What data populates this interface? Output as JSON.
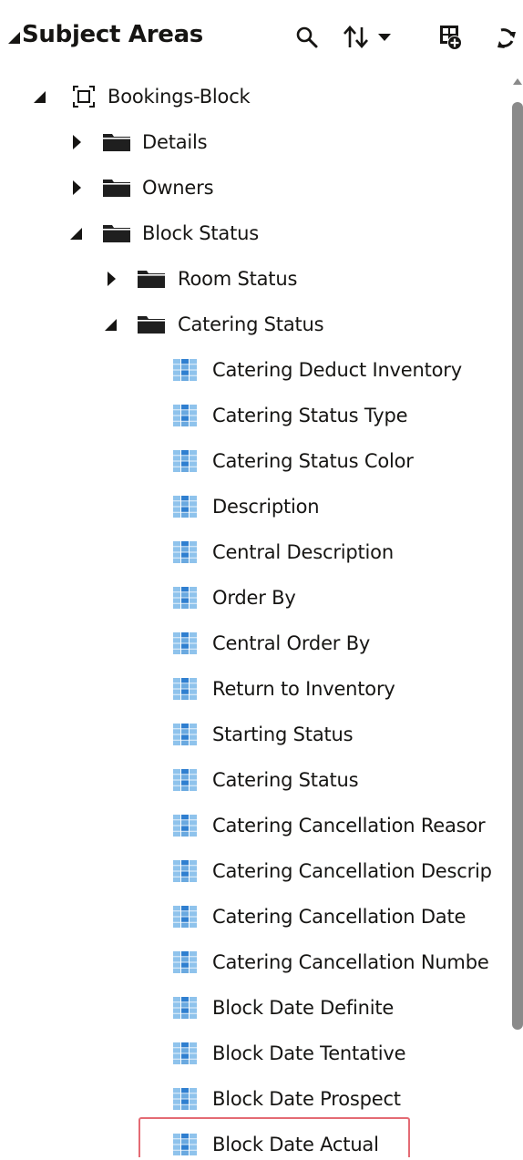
{
  "header": {
    "title": "Subject Areas",
    "icons": [
      "search-icon",
      "sort-icon",
      "chevron-down-icon",
      "add-to-canvas-icon",
      "refresh-icon"
    ]
  },
  "tree": {
    "nodes": [
      {
        "label": "Bookings-Block",
        "level": 0,
        "state": "expanded",
        "icon": "subject-area-icon"
      },
      {
        "label": "Details",
        "level": 1,
        "state": "collapsed",
        "icon": "folder-icon"
      },
      {
        "label": "Owners",
        "level": 1,
        "state": "collapsed",
        "icon": "folder-icon"
      },
      {
        "label": "Block Status",
        "level": 1,
        "state": "expanded",
        "icon": "folder-icon"
      },
      {
        "label": "Room Status",
        "level": 2,
        "state": "collapsed",
        "icon": "folder-icon"
      },
      {
        "label": "Catering Status",
        "level": 2,
        "state": "expanded",
        "icon": "folder-icon"
      },
      {
        "label": "Catering Deduct Inventory",
        "level": 3,
        "state": "leaf",
        "icon": "column-icon"
      },
      {
        "label": "Catering Status Type",
        "level": 3,
        "state": "leaf",
        "icon": "column-icon"
      },
      {
        "label": "Catering Status Color",
        "level": 3,
        "state": "leaf",
        "icon": "column-icon"
      },
      {
        "label": "Description",
        "level": 3,
        "state": "leaf",
        "icon": "column-icon"
      },
      {
        "label": "Central Description",
        "level": 3,
        "state": "leaf",
        "icon": "column-icon"
      },
      {
        "label": "Order By",
        "level": 3,
        "state": "leaf",
        "icon": "column-icon"
      },
      {
        "label": "Central Order By",
        "level": 3,
        "state": "leaf",
        "icon": "column-icon"
      },
      {
        "label": "Return to Inventory",
        "level": 3,
        "state": "leaf",
        "icon": "column-icon"
      },
      {
        "label": "Starting Status",
        "level": 3,
        "state": "leaf",
        "icon": "column-icon"
      },
      {
        "label": "Catering Status",
        "level": 3,
        "state": "leaf",
        "icon": "column-icon"
      },
      {
        "label": "Catering Cancellation Reasor",
        "level": 3,
        "state": "leaf",
        "icon": "column-icon"
      },
      {
        "label": "Catering Cancellation Descrip",
        "level": 3,
        "state": "leaf",
        "icon": "column-icon"
      },
      {
        "label": "Catering Cancellation Date",
        "level": 3,
        "state": "leaf",
        "icon": "column-icon"
      },
      {
        "label": "Catering Cancellation Numbe",
        "level": 3,
        "state": "leaf",
        "icon": "column-icon"
      },
      {
        "label": "Block Date Definite",
        "level": 3,
        "state": "leaf",
        "icon": "column-icon"
      },
      {
        "label": "Block Date Tentative",
        "level": 3,
        "state": "leaf",
        "icon": "column-icon"
      },
      {
        "label": "Block Date Prospect",
        "level": 3,
        "state": "leaf",
        "icon": "column-icon"
      },
      {
        "label": "Block Date Actual",
        "level": 3,
        "state": "leaf",
        "icon": "column-icon",
        "highlighted": true
      }
    ]
  },
  "colors": {
    "text": "#161513",
    "folder": "#1f1f1f",
    "column_icon_light": "#8fc3ec",
    "column_icon_dark": "#2f7fd0",
    "highlight_border": "#e46b74",
    "scrollbar": "#8a8a8a"
  }
}
